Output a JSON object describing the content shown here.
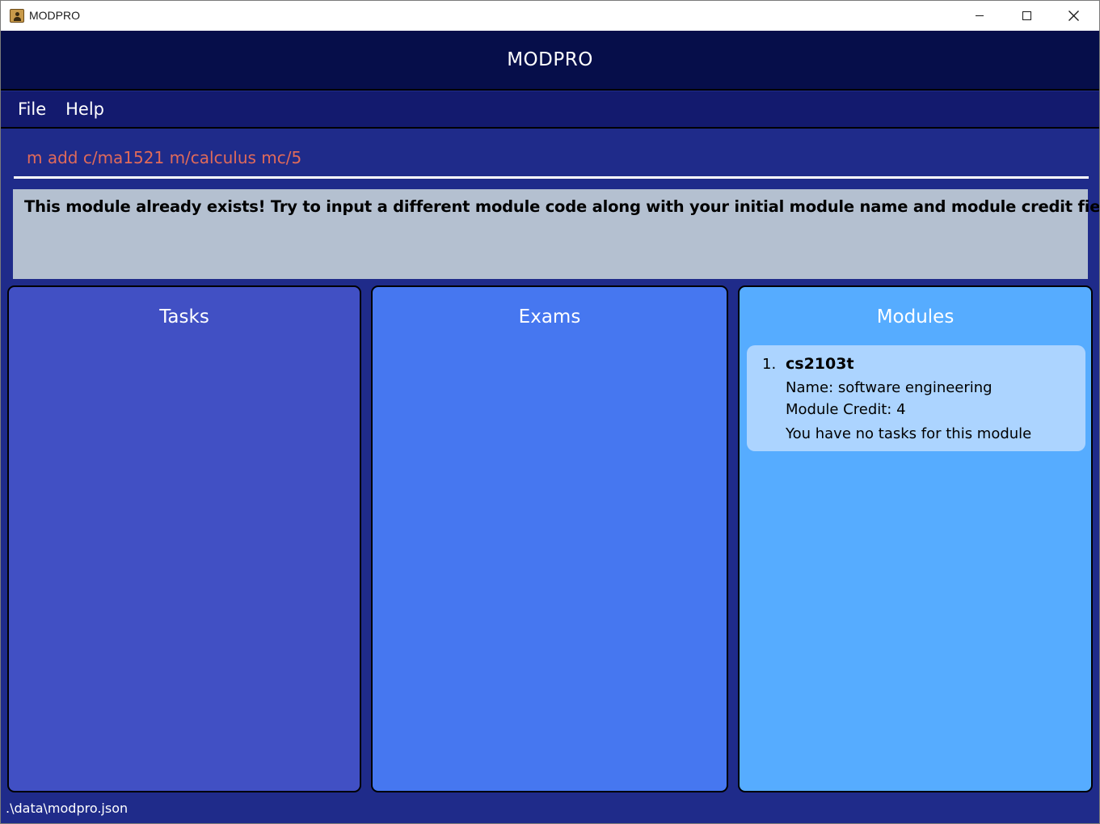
{
  "window": {
    "title": "MODPRO"
  },
  "header": {
    "title": "MODPRO"
  },
  "menu": {
    "items": [
      {
        "label": "File"
      },
      {
        "label": "Help"
      }
    ]
  },
  "command": {
    "value": "m add c/ma1521 m/calculus mc/5"
  },
  "result": {
    "message": "This module already exists! Try to input a different module code along with your initial module name and module credit fields."
  },
  "panels": {
    "tasks": {
      "title": "Tasks"
    },
    "exams": {
      "title": "Exams"
    },
    "modules": {
      "title": "Modules",
      "items": [
        {
          "index": "1.",
          "code": "cs2103t",
          "name": "Name: software engineering",
          "credit": "Module Credit: 4",
          "tasks": "You have no tasks for this module"
        }
      ]
    }
  },
  "status": {
    "path": ".\\data\\modpro.json"
  },
  "colors": {
    "header_bg": "#060e4a",
    "menu_bg": "#131a6e",
    "window_bg": "#1f2b8a",
    "command_text": "#e06a5a",
    "result_bg": "#b4c0d0",
    "tasks_bg": "#4150c4",
    "exams_bg": "#4677f0",
    "modules_bg": "#56acff",
    "module_card_bg": "#acd4ff"
  },
  "icons": {
    "app": "app-icon",
    "minimize": "minimize-icon",
    "maximize": "maximize-icon",
    "close": "close-icon"
  }
}
